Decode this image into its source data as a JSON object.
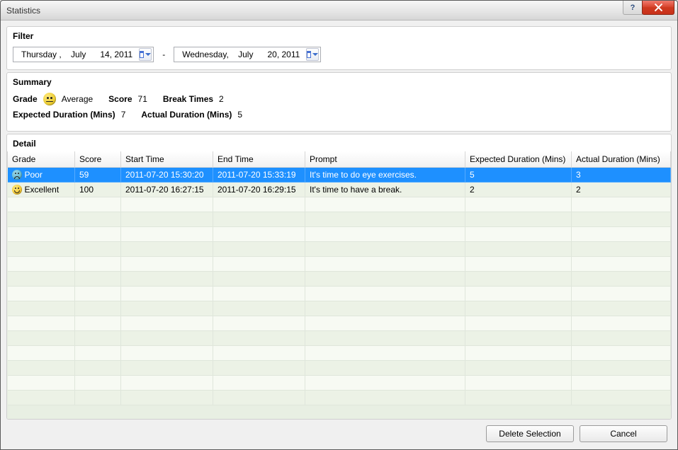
{
  "window": {
    "title": "Statistics"
  },
  "filter": {
    "heading": "Filter",
    "from": "Thursday ,    July      14, 2011",
    "separator": "-",
    "to": "Wednesday,    July      20, 2011"
  },
  "summary": {
    "heading": "Summary",
    "labels": {
      "grade": "Grade",
      "avg": "Average",
      "score": "Score",
      "break_times": "Break Times",
      "expected": "Expected Duration (Mins)",
      "actual": "Actual Duration (Mins)"
    },
    "values": {
      "score": "71",
      "break_times": "2",
      "expected": "7",
      "actual": "5"
    }
  },
  "detail": {
    "heading": "Detail",
    "columns": {
      "grade": "Grade",
      "score": "Score",
      "start": "Start Time",
      "end": "End Time",
      "prompt": "Prompt",
      "expected": "Expected Duration (Mins)",
      "actual": "Actual Duration (Mins)"
    },
    "rows": [
      {
        "grade_icon": "poor",
        "grade": "Poor",
        "score": "59",
        "start": "2011-07-20 15:30:20",
        "end": "2011-07-20 15:33:19",
        "prompt": "It's time to do eye exercises.",
        "expected": "5",
        "actual": "3",
        "selected": true
      },
      {
        "grade_icon": "excellent",
        "grade": "Excellent",
        "score": "100",
        "start": "2011-07-20 16:27:15",
        "end": "2011-07-20 16:29:15",
        "prompt": "It's time to have a break.",
        "expected": "2",
        "actual": "2",
        "selected": false
      }
    ]
  },
  "buttons": {
    "delete": "Delete Selection",
    "cancel": "Cancel"
  }
}
